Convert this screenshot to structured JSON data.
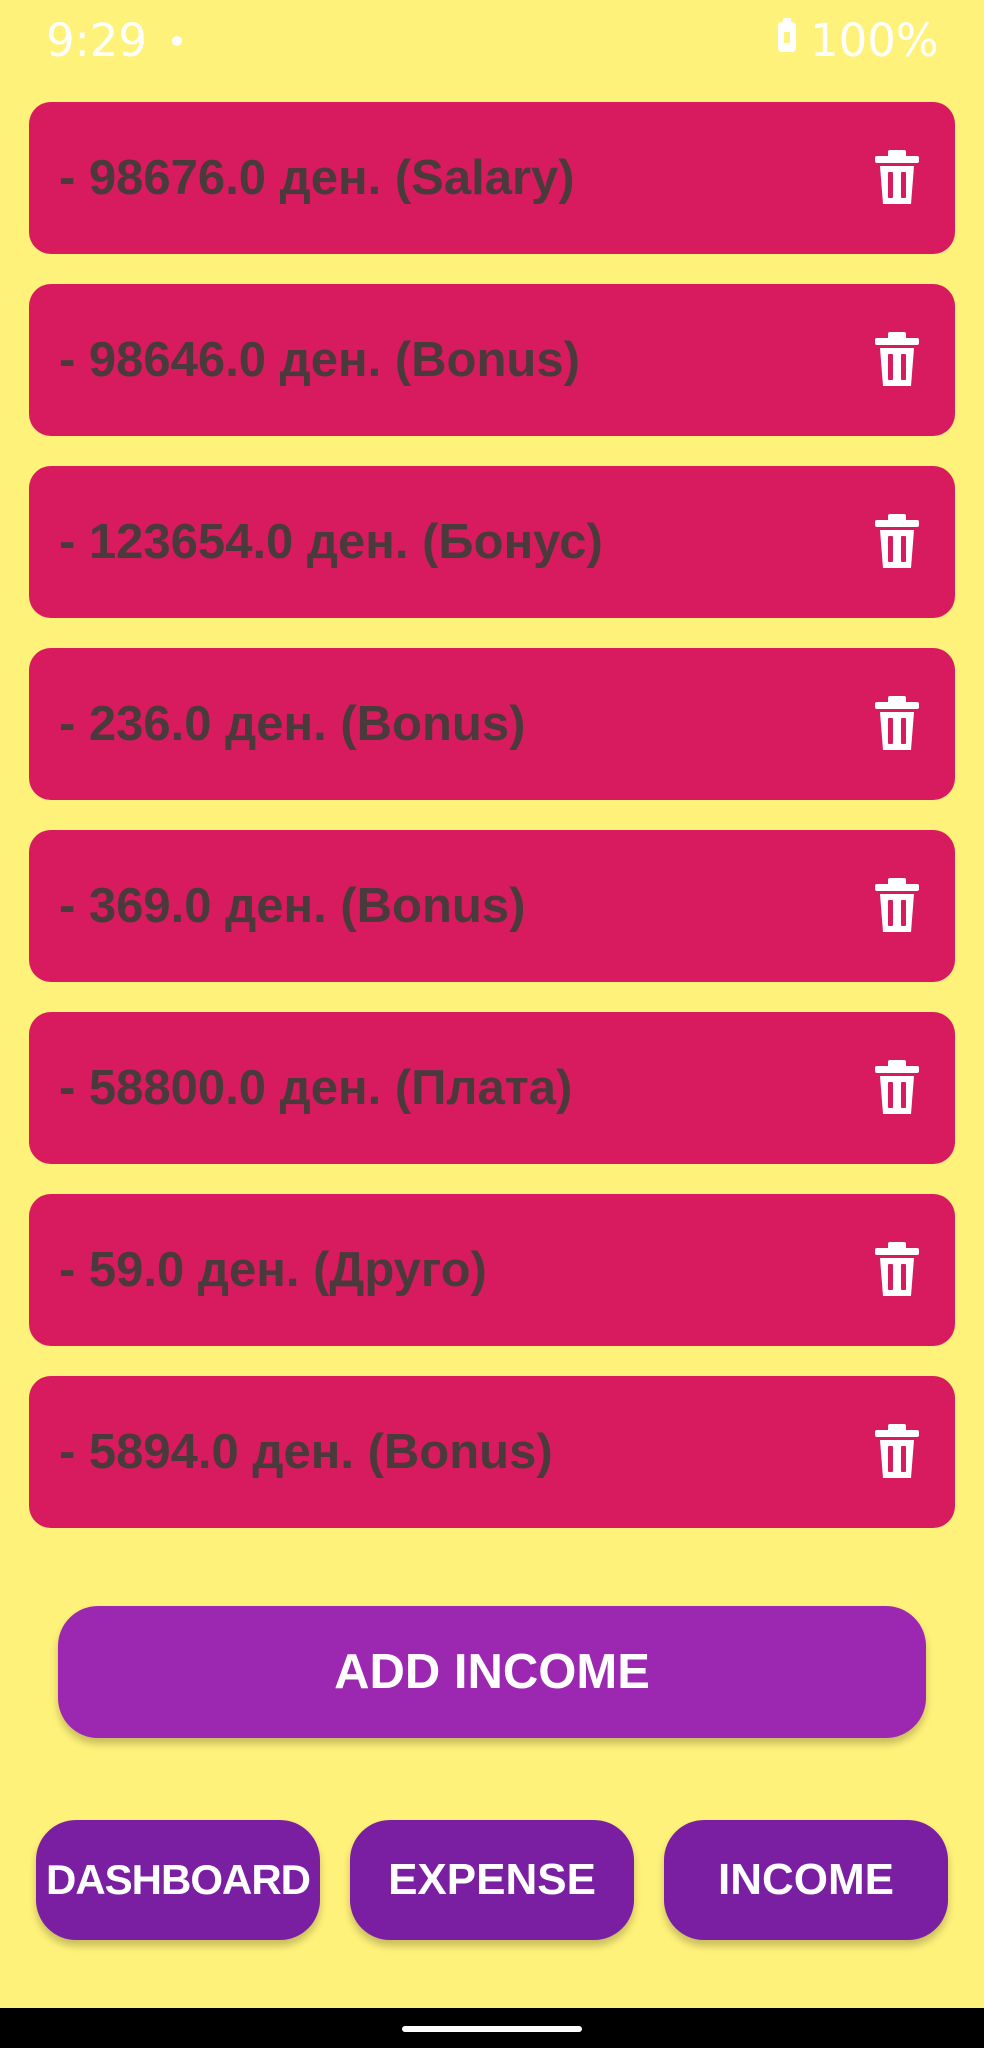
{
  "status_bar": {
    "time": "9:29",
    "battery": "100%"
  },
  "incomes": [
    {
      "label": "- 98676.0 ден. (Salary)"
    },
    {
      "label": "- 98646.0 ден. (Bonus)"
    },
    {
      "label": "- 123654.0 ден. (Бонус)"
    },
    {
      "label": "- 236.0 ден. (Bonus)"
    },
    {
      "label": "- 369.0 ден. (Bonus)"
    },
    {
      "label": "- 58800.0 ден. (Плата)"
    },
    {
      "label": "- 59.0 ден. (Друго)"
    },
    {
      "label": "- 5894.0 ден. (Bonus)"
    }
  ],
  "add_button": "ADD INCOME",
  "nav": {
    "dashboard": "DASHBOARD",
    "expense": "EXPENSE",
    "income": "INCOME"
  },
  "colors": {
    "background": "#fff27a",
    "card": "#d81b5e",
    "card_text": "#4a3a3c",
    "primary_button": "#9c27b0",
    "nav_button": "#7b1fa2"
  },
  "icons": {
    "delete": "trash-icon"
  }
}
